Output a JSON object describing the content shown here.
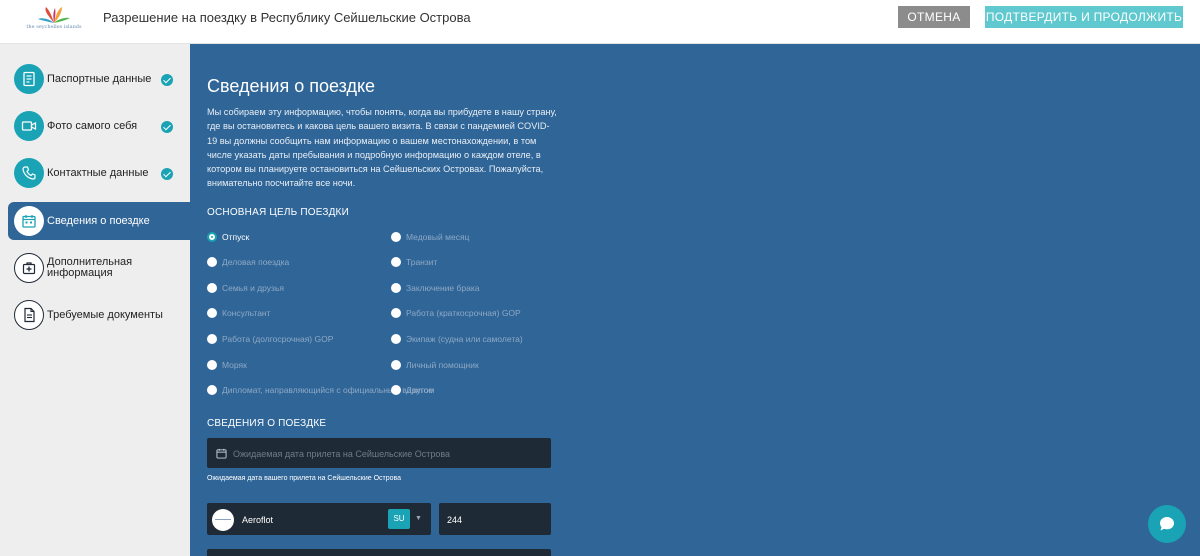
{
  "header": {
    "logo_text": "the seychelles islands",
    "title": "Разрешение на поездку в Республику Сейшельские Острова",
    "cancel_label": "ОТМЕНА",
    "confirm_label": "ПОДТВЕРДИТЬ И ПРОДОЛЖИТЬ"
  },
  "colors": {
    "accent": "#1aa3b5",
    "content_bg": "#2f6597",
    "sidebar_bg": "#eeeeee",
    "confirm_button": "#5fc9cf",
    "cancel_button": "#8c8c8c"
  },
  "sidebar": {
    "items": [
      {
        "label": "Паспортные данные",
        "icon": "passport-icon",
        "completed": true
      },
      {
        "label": "Фото самого себя",
        "icon": "video-camera-icon",
        "completed": true
      },
      {
        "label": "Контактные данные",
        "icon": "phone-icon",
        "completed": true
      },
      {
        "label": "Сведения о поездке",
        "icon": "calendar-icon",
        "active": true
      },
      {
        "label": "Дополнительная информация",
        "icon": "medical-kit-icon"
      },
      {
        "label": "Требуемые документы",
        "icon": "document-icon"
      }
    ]
  },
  "main": {
    "heading": "Сведения о поездке",
    "intro": "Мы собираем эту информацию, чтобы понять, когда вы прибудете в нашу страну, где вы остановитесь и какова цель вашего визита. В связи с пандемией COVID-19 вы должны сообщить нам информацию о вашем местонахождении, в том числе указать даты пребывания и подробную информацию о каждом отеле, в котором вы планируете остановиться на Сейшельских Островах. Пожалуйста, внимательно посчитайте все ночи.",
    "purpose_title": "ОСНОВНАЯ ЦЕЛЬ ПОЕЗДКИ",
    "purpose_options": [
      {
        "label": "Отпуск",
        "selected": true
      },
      {
        "label": "Медовый месяц"
      },
      {
        "label": "Деловая поездка"
      },
      {
        "label": "Транзит"
      },
      {
        "label": "Семья и друзья"
      },
      {
        "label": "Заключение брака"
      },
      {
        "label": "Консультант"
      },
      {
        "label": "Работа (краткосрочная) GOP"
      },
      {
        "label": "Работа (долгосрочная) GOP"
      },
      {
        "label": "Экипаж (судна или самолета)"
      },
      {
        "label": "Моряк"
      },
      {
        "label": "Личный помощник"
      },
      {
        "label": "Дипломат, направляющийся с официальным визитом"
      },
      {
        "label": "Другое"
      }
    ],
    "trip_title": "СВЕДЕНИЯ О ПОЕЗДКЕ",
    "arrival_placeholder": "Ожидаемая дата прилета на Сейшельские Острова",
    "arrival_hint": "Ожидаемая дата вашего прилета на Сейшельские Острова",
    "airline_name": "Aeroflot",
    "airline_code": "SU",
    "flight_number": "244"
  }
}
